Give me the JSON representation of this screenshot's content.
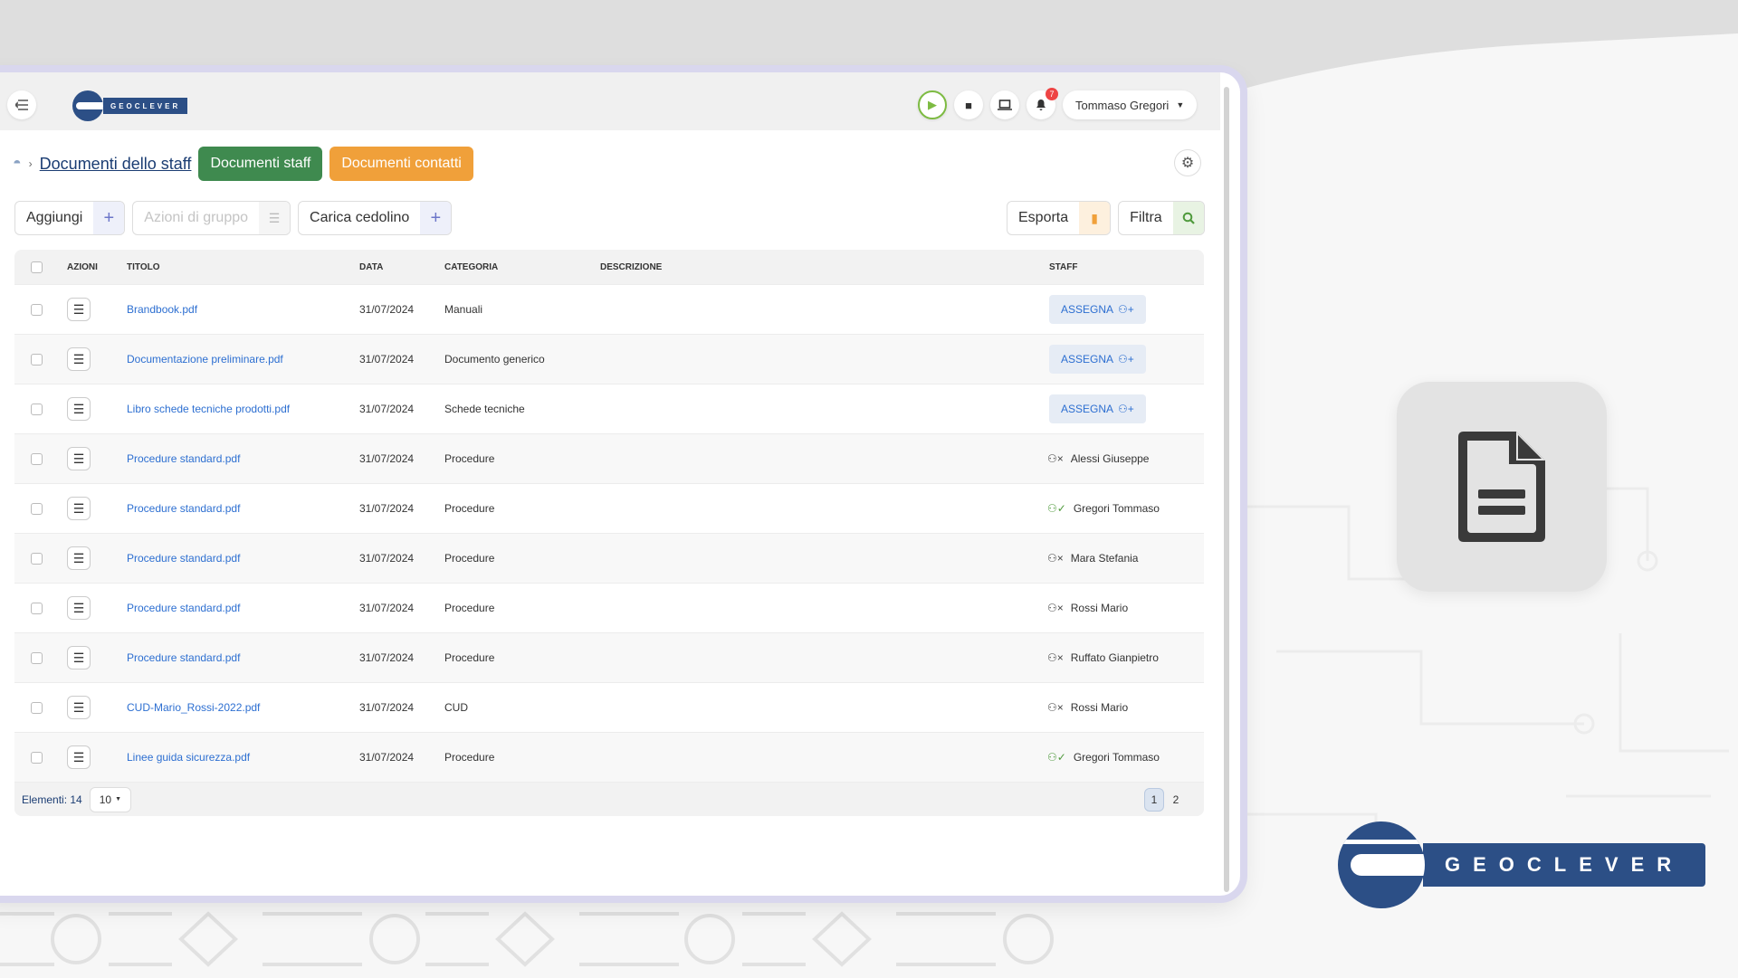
{
  "app": {
    "brand": "GEOCLEVER"
  },
  "topbar": {
    "user_name": "Tommaso Gregori",
    "notification_count": "7"
  },
  "page": {
    "title": "Documenti dello staff",
    "tab_staff": "Documenti staff",
    "tab_contacts": "Documenti contatti"
  },
  "toolbar": {
    "add_label": "Aggiungi",
    "group_actions_label": "Azioni di gruppo",
    "upload_payslip_label": "Carica cedolino",
    "export_label": "Esporta",
    "filter_label": "Filtra"
  },
  "table": {
    "headers": {
      "actions": "AZIONI",
      "title": "TITOLO",
      "date": "DATA",
      "category": "CATEGORIA",
      "description": "DESCRIZIONE",
      "staff": "STAFF"
    },
    "assign_label": "ASSEGNA",
    "rows": [
      {
        "title": "Brandbook.pdf",
        "date": "31/07/2024",
        "category": "Manuali",
        "description": "",
        "staff": "",
        "staff_status": "unassigned"
      },
      {
        "title": "Documentazione preliminare.pdf",
        "date": "31/07/2024",
        "category": "Documento generico",
        "description": "",
        "staff": "",
        "staff_status": "unassigned"
      },
      {
        "title": "Libro schede tecniche prodotti.pdf",
        "date": "31/07/2024",
        "category": "Schede tecniche",
        "description": "",
        "staff": "",
        "staff_status": "unassigned"
      },
      {
        "title": "Procedure standard.pdf",
        "date": "31/07/2024",
        "category": "Procedure",
        "description": "",
        "staff": "Alessi Giuseppe",
        "staff_status": "pending"
      },
      {
        "title": "Procedure standard.pdf",
        "date": "31/07/2024",
        "category": "Procedure",
        "description": "",
        "staff": "Gregori Tommaso",
        "staff_status": "confirmed"
      },
      {
        "title": "Procedure standard.pdf",
        "date": "31/07/2024",
        "category": "Procedure",
        "description": "",
        "staff": "Mara Stefania",
        "staff_status": "pending"
      },
      {
        "title": "Procedure standard.pdf",
        "date": "31/07/2024",
        "category": "Procedure",
        "description": "",
        "staff": "Rossi Mario",
        "staff_status": "pending"
      },
      {
        "title": "Procedure standard.pdf",
        "date": "31/07/2024",
        "category": "Procedure",
        "description": "",
        "staff": "Ruffato Gianpietro",
        "staff_status": "pending"
      },
      {
        "title": "CUD-Mario_Rossi-2022.pdf",
        "date": "31/07/2024",
        "category": "CUD",
        "description": "",
        "staff": "Rossi Mario",
        "staff_status": "pending"
      },
      {
        "title": "Linee guida sicurezza.pdf",
        "date": "31/07/2024",
        "category": "Procedure",
        "description": "",
        "staff": "Gregori Tommaso",
        "staff_status": "confirmed"
      }
    ],
    "footer": {
      "count_label": "Elementi: 14",
      "page_size": "10",
      "pages": [
        "1",
        "2"
      ],
      "current_page": "1"
    }
  },
  "colors": {
    "brand_blue": "#2c4f86",
    "green": "#3f8a4f",
    "orange": "#f0a03a",
    "link": "#2d6fd1"
  }
}
